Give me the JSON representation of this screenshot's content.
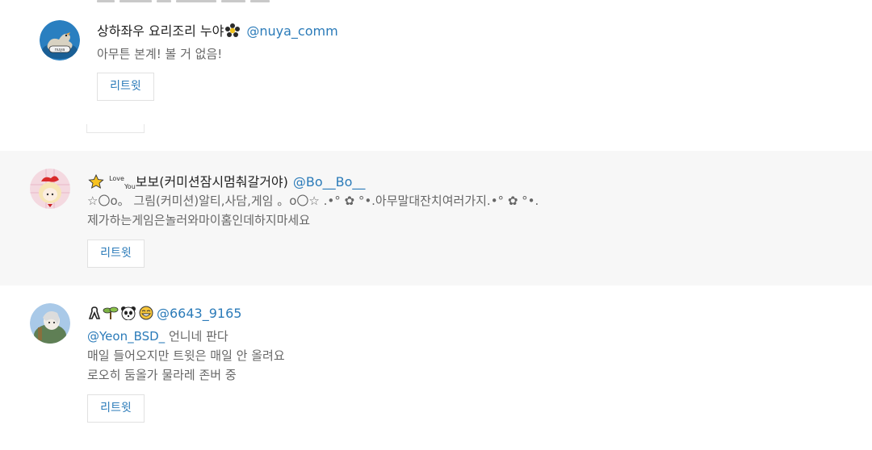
{
  "users": [
    {
      "display_name": "상하좌우 요리조리 누야",
      "handle": "@nuya_comm",
      "bio_lines": [
        "아무튼 본계! 볼 거 없음!"
      ],
      "retweet_label": "리트윗",
      "avatar_icon": "duck-avatar-icon",
      "accent": "#1a6fb0"
    },
    {
      "star_emoji": "⭐",
      "love_text": "Love",
      "you_text": "You",
      "display_name": "보보(커미션잠시멈춰갈거야)",
      "handle": "@Bo__Bo__",
      "bio_lines": [
        "☆〇o。 그림(커미션)알티,사담,게임 。o〇☆ .•° ✿ °•.아무말대잔치여러가지.•° ✿ °•.",
        "제가하는게임은놀러와마이홈인데하지마세요"
      ],
      "retweet_label": "리트윗",
      "avatar_icon": "girl-avatar-icon"
    },
    {
      "emoji_names": [
        "ribbon-icon",
        "sprout-icon",
        "panda-icon",
        "grin-icon"
      ],
      "handle": "@6643_9165",
      "bio_mention": "@Yeon_BSD_",
      "bio_first_rest": " 언니네 판다",
      "bio_lines": [
        "매일 들어오지만 트윗은 매일 안 올려요",
        "로오히 둠올가 물라레 존버 중"
      ],
      "retweet_label": "리트윗",
      "avatar_icon": "knight-avatar-icon"
    }
  ],
  "colors": {
    "link": "#2b7bb9",
    "bio": "#666666",
    "name": "#222222",
    "alt_bg": "#f7f7f7",
    "border": "#e1e1e1"
  }
}
